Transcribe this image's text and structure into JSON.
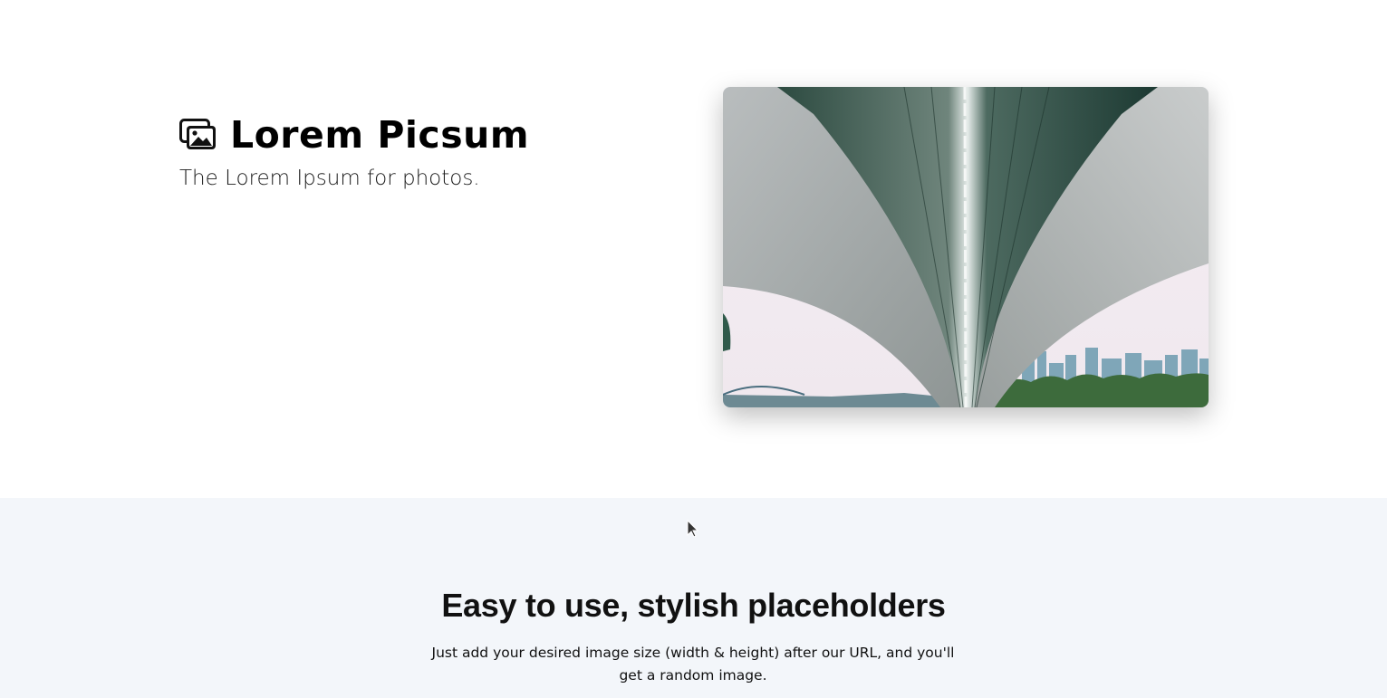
{
  "hero": {
    "title": "Lorem Picsum",
    "tagline": "The Lorem Ipsum for photos.",
    "logo_icon": "images-icon",
    "photo_subject": "bridge-underside-photo"
  },
  "features": {
    "heading": "Easy to use, stylish placeholders",
    "description": "Just add your desired image size (width & height) after our URL, and you'll get a random image."
  },
  "colors": {
    "hero_bg": "#ffffff",
    "features_bg": "#f3f6fa",
    "text": "#000000"
  }
}
